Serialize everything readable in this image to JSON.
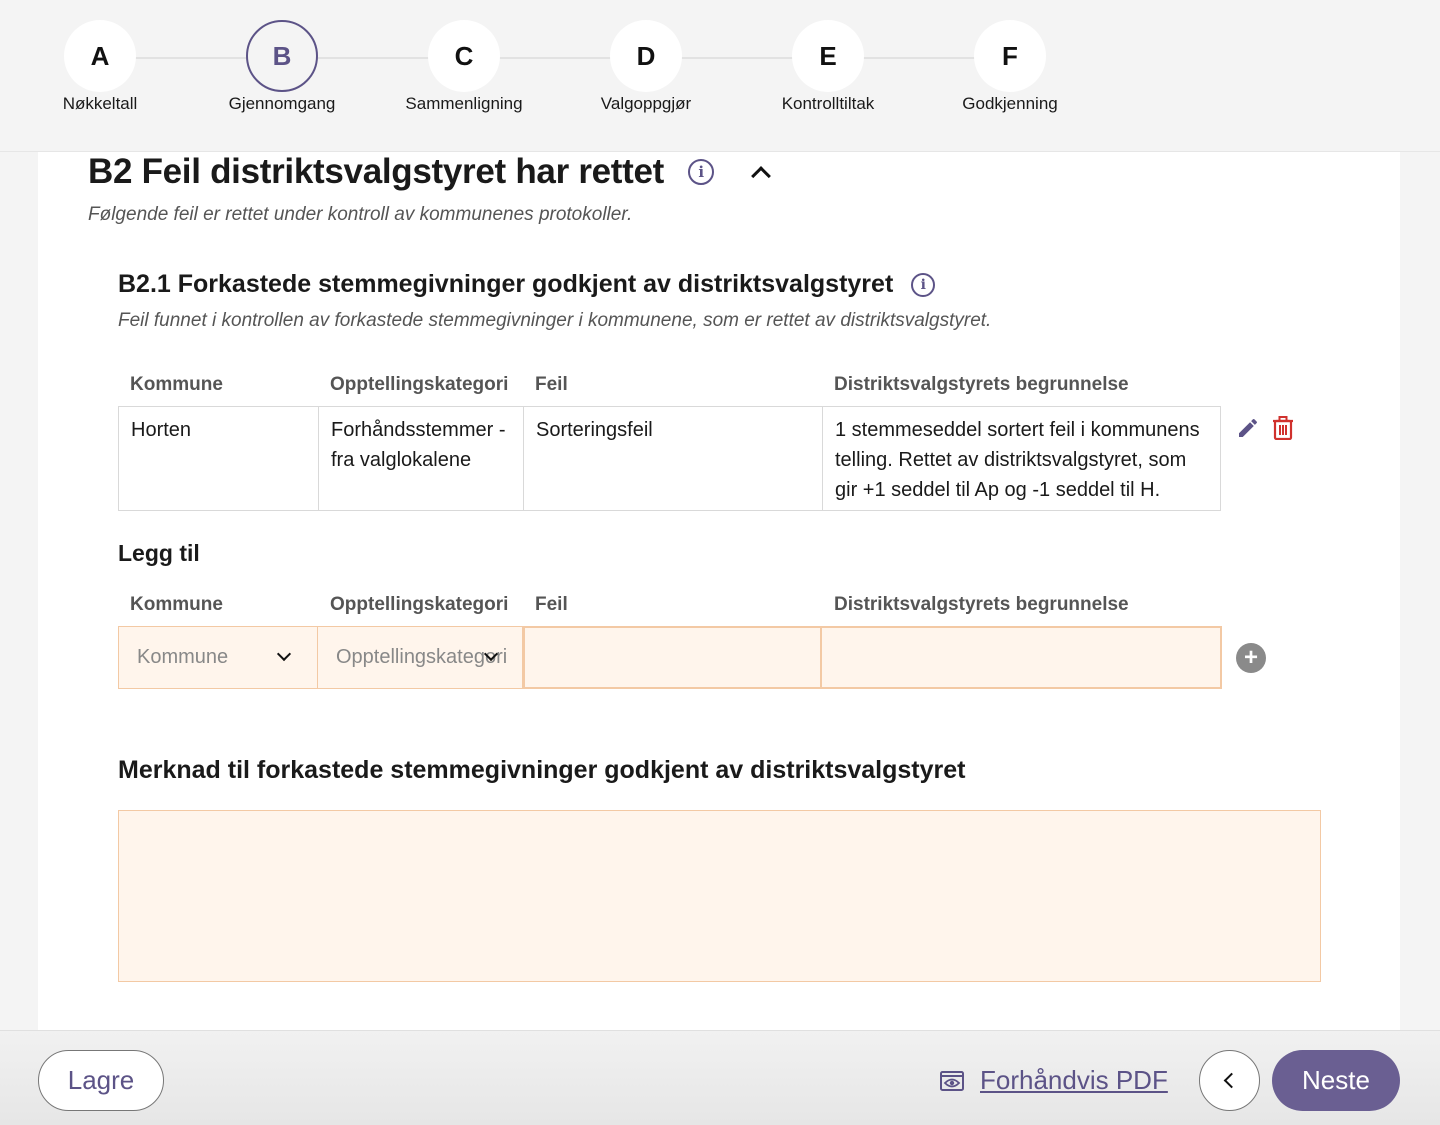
{
  "stepper": {
    "steps": [
      {
        "letter": "A",
        "label": "Nøkkeltall"
      },
      {
        "letter": "B",
        "label": "Gjennomgang"
      },
      {
        "letter": "C",
        "label": "Sammenligning"
      },
      {
        "letter": "D",
        "label": "Valgoppgjør"
      },
      {
        "letter": "E",
        "label": "Kontrolltiltak"
      },
      {
        "letter": "F",
        "label": "Godkjenning"
      }
    ],
    "active": "B"
  },
  "section": {
    "title": "B2 Feil distriktsvalgstyret har rettet",
    "description": "Følgende feil er rettet under kontroll av kommunenes protokoller.",
    "info_icon": "info-icon",
    "toggle_icon": "chevron-up-icon"
  },
  "subsection": {
    "title": "B2.1 Forkastede stemmegivninger godkjent av distriktsvalgstyret",
    "description": "Feil funnet i kontrollen av forkastede stemmegivninger i kommunene, som er rettet av distriktsvalgstyret."
  },
  "table": {
    "headers": [
      "Kommune",
      "Opptellingskategori",
      "Feil",
      "Distriktsvalgstyrets begrunnelse"
    ],
    "rows": [
      {
        "kommune": "Horten",
        "kategori": "Forhåndsstemmer - fra valglokalene",
        "feil": "Sorteringsfeil",
        "begrunnelse": "1 stemmeseddel sortert feil i kommunens telling. Rettet av distriktsvalgstyret, som gir +1 seddel til Ap og -1 seddel til H."
      }
    ],
    "row_icons": [
      "pencil-icon",
      "trash-icon"
    ]
  },
  "add_form": {
    "title": "Legg til",
    "headers": [
      "Kommune",
      "Opptellingskategori",
      "Feil",
      "Distriktsvalgstyrets begrunnelse"
    ],
    "kommune_placeholder": "Kommune",
    "kategori_placeholder": "Opptellingskategori",
    "feil_value": "",
    "begrunnelse_value": "",
    "add_icon": "plus-circle-icon"
  },
  "merknad": {
    "title": "Merknad til forkastede stemmegivninger godkjent av distriktsvalgstyret",
    "value": ""
  },
  "footer": {
    "save_label": "Lagre",
    "preview_label": "Forhåndvis PDF",
    "back_icon": "chevron-left-icon",
    "next_label": "Neste"
  },
  "colors": {
    "accent": "#5c5387",
    "primary_button": "#6a5f92",
    "input_bg": "#fff5ec",
    "input_border": "#f3c9a4",
    "delete": "#d0312d"
  }
}
